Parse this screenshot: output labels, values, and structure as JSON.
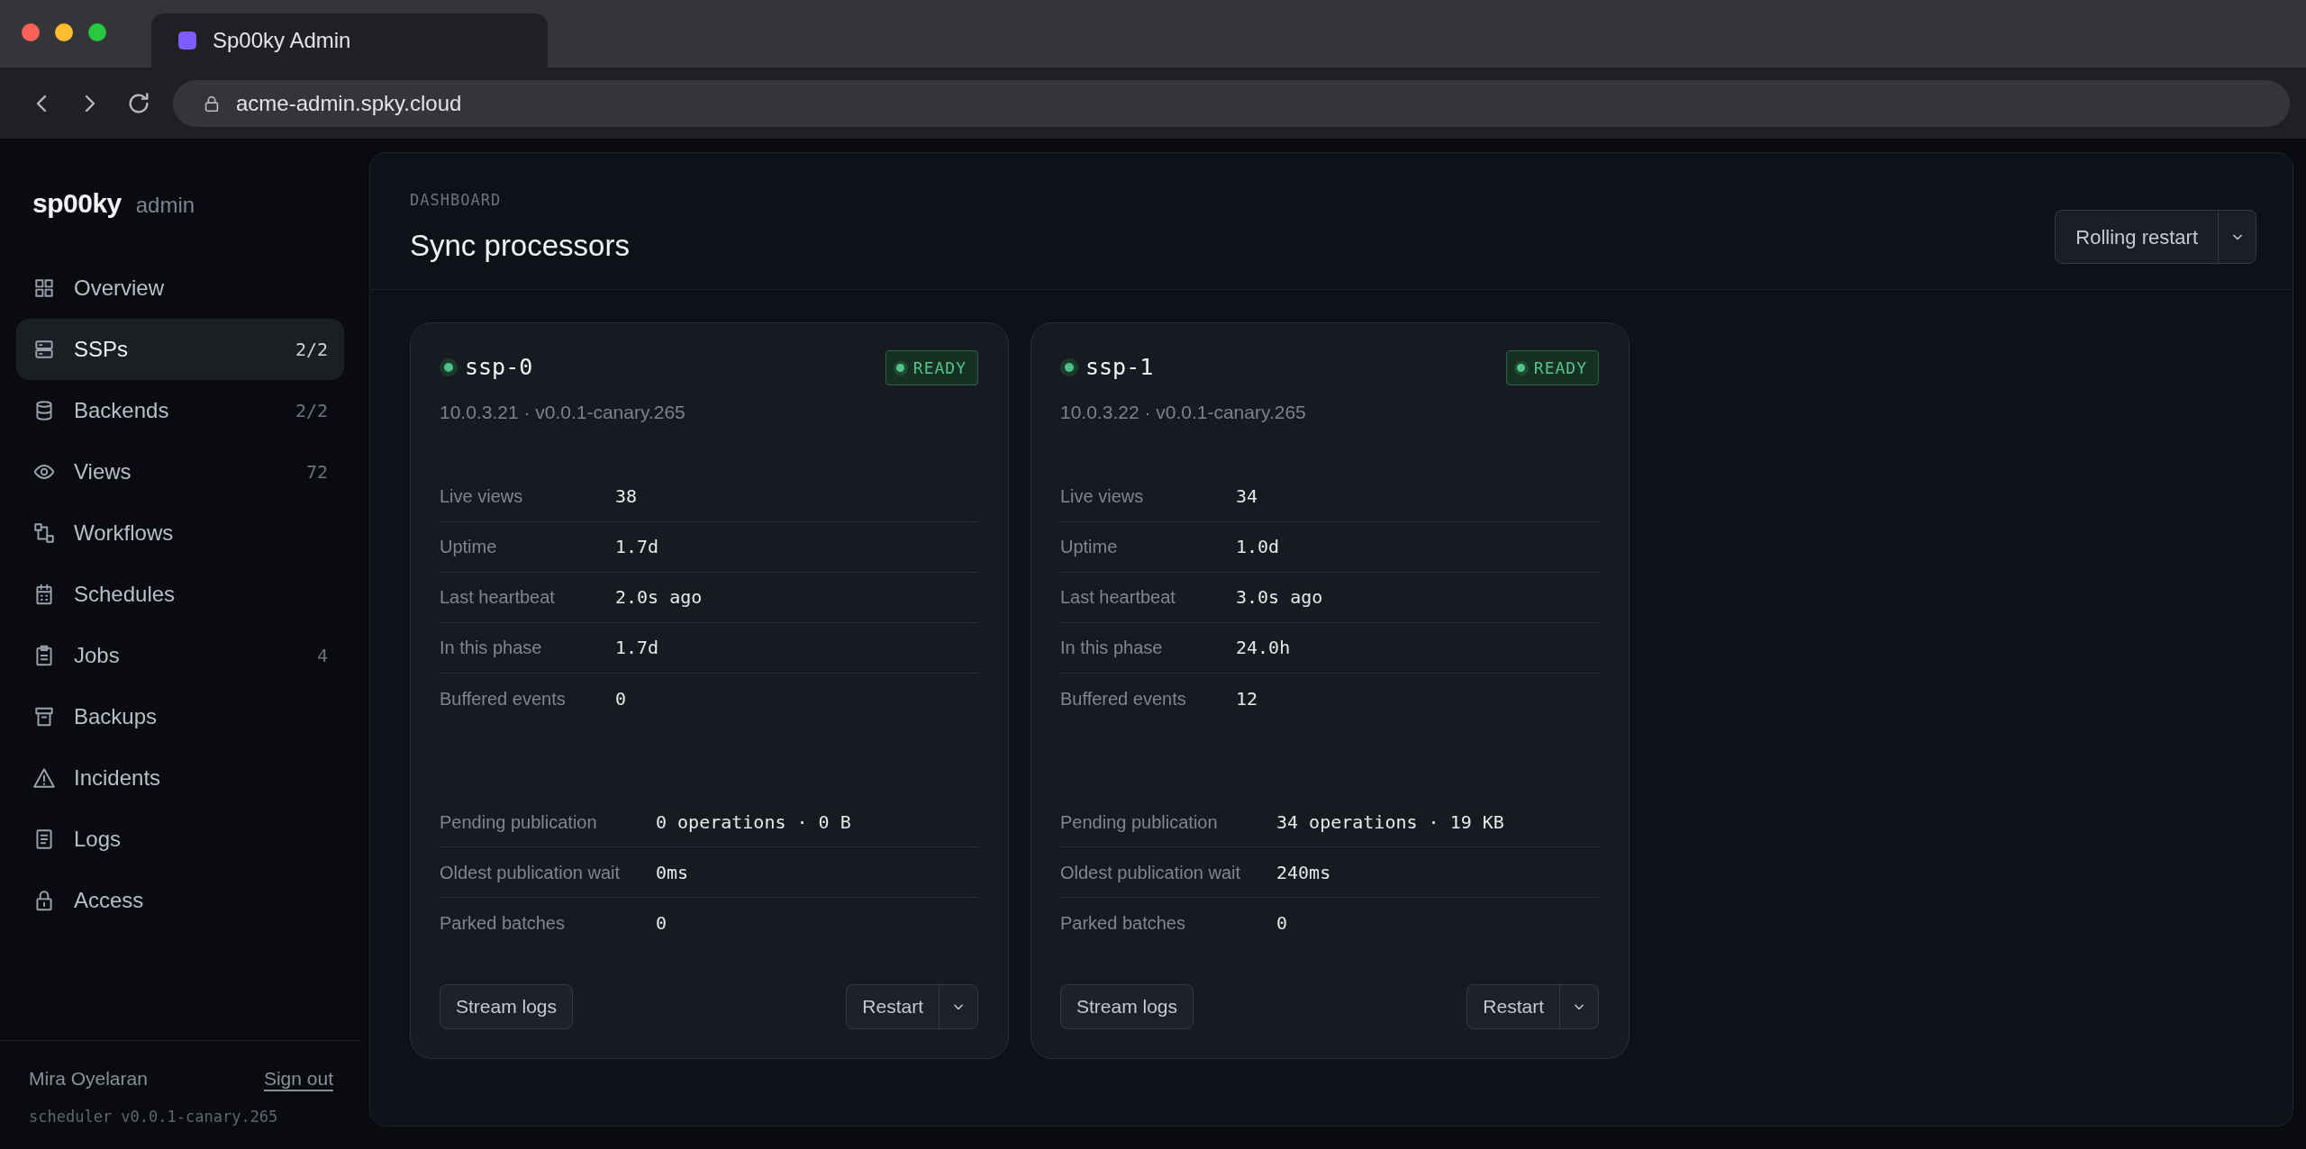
{
  "browser": {
    "tab_title": "Sp00ky Admin",
    "url": "acme-admin.spky.cloud"
  },
  "sidebar": {
    "logo": "sp00ky",
    "logo_suffix": "admin",
    "items": [
      {
        "label": "Overview",
        "selected": false
      },
      {
        "label": "SSPs",
        "count": "2/2",
        "selected": true
      },
      {
        "label": "Backends",
        "count": "2/2",
        "selected": false
      },
      {
        "label": "Views",
        "count": "72",
        "selected": false
      },
      {
        "label": "Workflows",
        "selected": false
      },
      {
        "label": "Schedules",
        "selected": false
      },
      {
        "label": "Jobs",
        "count": "4",
        "selected": false
      },
      {
        "label": "Backups",
        "selected": false
      },
      {
        "label": "Incidents",
        "selected": false
      },
      {
        "label": "Logs",
        "selected": false
      },
      {
        "label": "Access",
        "selected": false
      }
    ],
    "user": "Mira Oyelaran",
    "sign_out": "Sign out",
    "version": "scheduler v0.0.1-canary.265"
  },
  "header": {
    "eyebrow": "DASHBOARD",
    "title": "Sync processors",
    "action": "Rolling restart"
  },
  "processors": [
    {
      "name": "ssp-0",
      "online": true,
      "status": "READY",
      "address": "10.0.3.21 · v0.0.1-canary.265",
      "metrics": [
        {
          "label": "Live views",
          "value": "38"
        },
        {
          "label": "Uptime",
          "value": "1.7d"
        },
        {
          "label": "Last heartbeat",
          "value": "2.0s ago"
        },
        {
          "label": "In this phase",
          "value": "1.7d"
        },
        {
          "label": "Buffered events",
          "value": "0"
        }
      ],
      "publication": [
        {
          "label": "Pending publication",
          "value": "0 operations · 0 B"
        },
        {
          "label": "Oldest publication wait",
          "value": "0ms"
        },
        {
          "label": "Parked batches",
          "value": "0"
        }
      ],
      "logs_button": "Stream logs",
      "restart_button": "Restart"
    },
    {
      "name": "ssp-1",
      "online": true,
      "status": "READY",
      "address": "10.0.3.22 · v0.0.1-canary.265",
      "metrics": [
        {
          "label": "Live views",
          "value": "34"
        },
        {
          "label": "Uptime",
          "value": "1.0d"
        },
        {
          "label": "Last heartbeat",
          "value": "3.0s ago"
        },
        {
          "label": "In this phase",
          "value": "24.0h"
        },
        {
          "label": "Buffered events",
          "value": "12"
        }
      ],
      "publication": [
        {
          "label": "Pending publication",
          "value": "34 operations · 19 KB"
        },
        {
          "label": "Oldest publication wait",
          "value": "240ms"
        },
        {
          "label": "Parked batches",
          "value": "0"
        }
      ],
      "logs_button": "Stream logs",
      "restart_button": "Restart"
    }
  ]
}
